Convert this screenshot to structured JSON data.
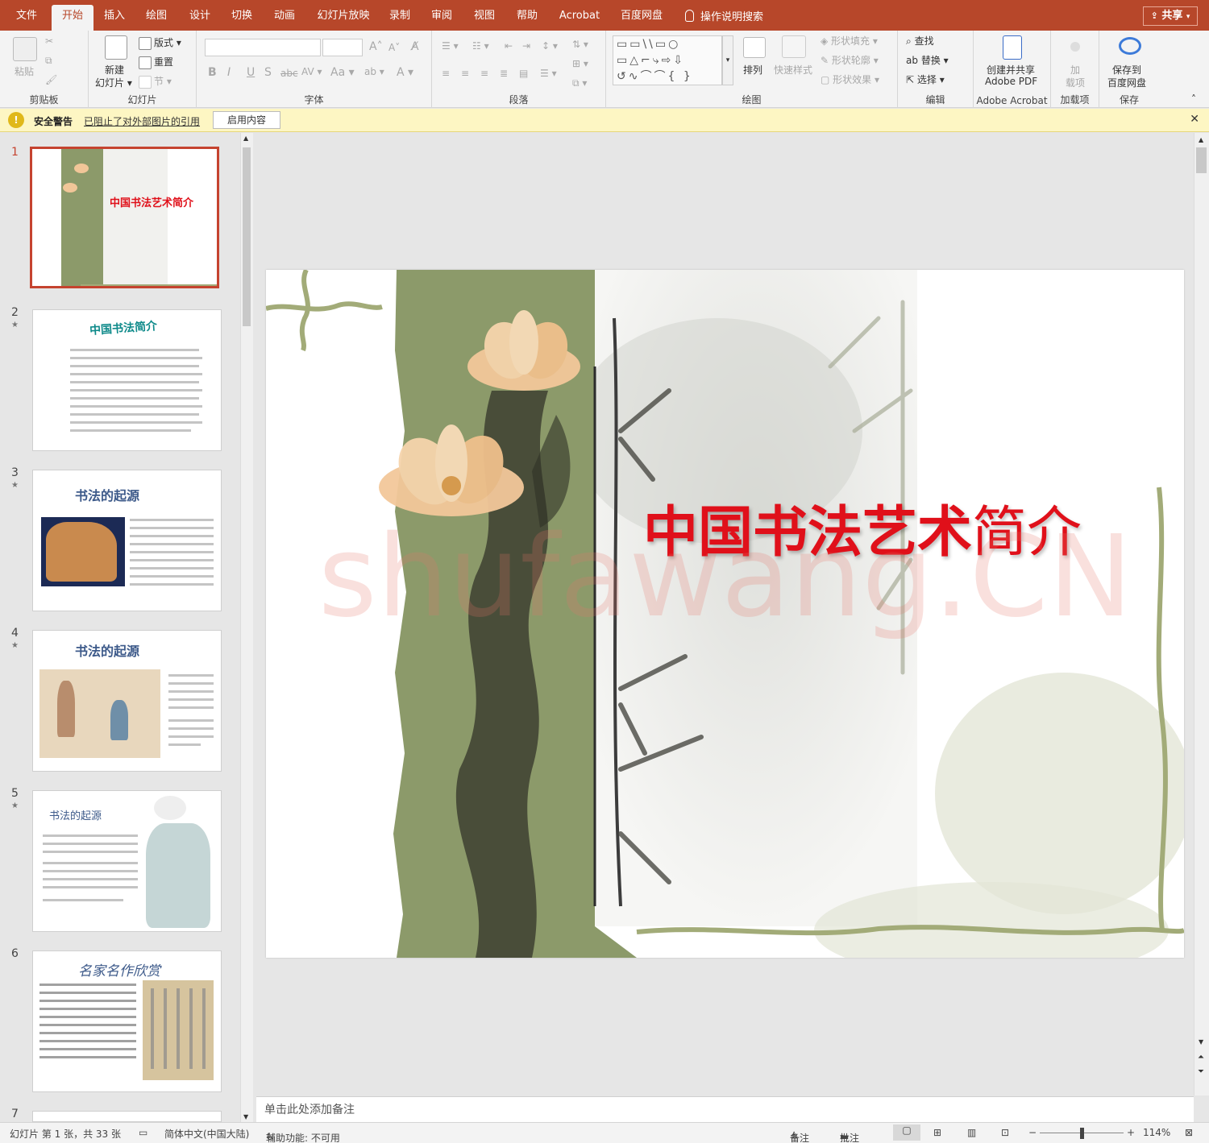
{
  "tabs": [
    {
      "label": "文件"
    },
    {
      "label": "开始"
    },
    {
      "label": "插入"
    },
    {
      "label": "绘图"
    },
    {
      "label": "设计"
    },
    {
      "label": "切换"
    },
    {
      "label": "动画"
    },
    {
      "label": "幻灯片放映"
    },
    {
      "label": "录制"
    },
    {
      "label": "审阅"
    },
    {
      "label": "视图"
    },
    {
      "label": "帮助"
    },
    {
      "label": "Acrobat"
    },
    {
      "label": "百度网盘"
    }
  ],
  "tellme": "操作说明搜索",
  "share": "共享",
  "ribbon": {
    "clipboard": {
      "paste": "粘贴",
      "label": "剪贴板"
    },
    "slides": {
      "new_slide_1": "新建",
      "new_slide_2": "幻灯片",
      "layout": "版式",
      "reset": "重置",
      "section": "节",
      "label": "幻灯片"
    },
    "font": {
      "label": "字体"
    },
    "paragraph": {
      "label": "段落"
    },
    "drawing": {
      "arrange": "排列",
      "quick_styles": "快速样式",
      "shape_fill": "形状填充",
      "shape_outline": "形状轮廓",
      "shape_effects": "形状效果",
      "label": "绘图"
    },
    "editing": {
      "find": "查找",
      "replace": "替换",
      "select": "选择",
      "label": "编辑"
    },
    "acrobat": {
      "line1": "创建并共享",
      "line2": "Adobe PDF",
      "label": "Adobe Acrobat"
    },
    "addins": {
      "line1": "加",
      "line2": "载项",
      "label": "加载项"
    },
    "save": {
      "line1": "保存到",
      "line2": "百度网盘",
      "label": "保存"
    }
  },
  "warning": {
    "title": "安全警告",
    "message": "已阻止了对外部图片的引用",
    "button": "启用内容"
  },
  "thumbnails": [
    {
      "num": "1",
      "title": "中国书法艺术简介"
    },
    {
      "num": "2",
      "title": "中国书法简介"
    },
    {
      "num": "3",
      "title": "书法的起源"
    },
    {
      "num": "4",
      "title": "书法的起源"
    },
    {
      "num": "5",
      "title": "书法的起源"
    },
    {
      "num": "6",
      "title": "名家名作欣赏"
    },
    {
      "num": "7",
      "title": ""
    }
  ],
  "slide": {
    "title_bold": "中国书法艺术",
    "title_light": "简介",
    "watermark": "shufawang.CN"
  },
  "notes_placeholder": "单击此处添加备注",
  "status": {
    "slide_info": "幻灯片 第 1 张，共 33 张",
    "language": "简体中文(中国大陆)",
    "accessibility": "辅助功能: 不可用",
    "notes": "备注",
    "comments": "批注",
    "zoom": "114%"
  },
  "colors": {
    "accent": "#b7472a",
    "title_red": "#e0101a",
    "vine_green": "#a2ab78"
  }
}
